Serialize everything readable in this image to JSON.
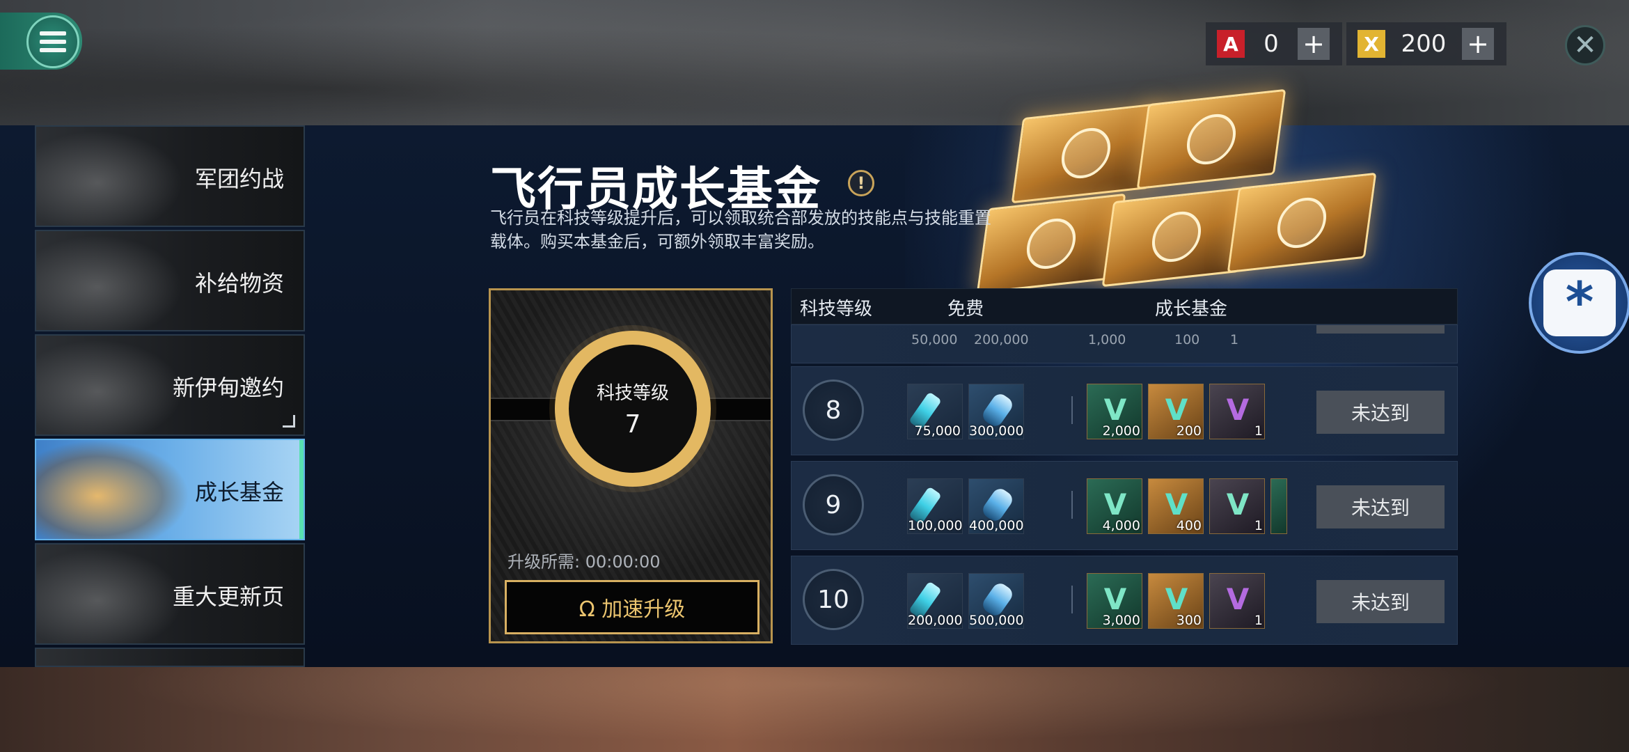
{
  "currency": {
    "item1": {
      "icon": "red-a-currency-icon",
      "value": "0",
      "plus": "+"
    },
    "item2": {
      "icon": "gold-x-currency-icon",
      "value": "200",
      "plus": "+"
    },
    "close": "✕"
  },
  "sidebar": {
    "items": [
      {
        "label": "军团约战"
      },
      {
        "label": "补给物资"
      },
      {
        "label": "新伊甸邀约"
      },
      {
        "label": "成长基金"
      },
      {
        "label": "重大更新页"
      }
    ]
  },
  "fund": {
    "title": "飞行员成长基金",
    "info": "!",
    "description": "飞行员在科技等级提升后，可以领取统合部发放的技能点与技能重置载体。购买本基金后，可额外领取丰富奖励。"
  },
  "level_card": {
    "label": "科技等级",
    "value": "7",
    "upgrade_need": "升级所需: 00:00:00",
    "speed_button": "Ω 加速升级"
  },
  "table": {
    "headers": {
      "level": "科技等级",
      "free": "免费",
      "fund": "成长基金"
    },
    "partial_row": {
      "free": [
        "50,000",
        "200,000"
      ],
      "fund": [
        "1,000",
        "100",
        "1"
      ]
    },
    "rows": [
      {
        "level": "8",
        "free": [
          "75,000",
          "300,000"
        ],
        "fund": [
          "2,000",
          "200",
          "1"
        ],
        "status": "未达到"
      },
      {
        "level": "9",
        "free": [
          "100,000",
          "400,000"
        ],
        "fund": [
          "4,000",
          "400",
          "1"
        ],
        "status": "未达到"
      },
      {
        "level": "10",
        "free": [
          "200,000",
          "500,000"
        ],
        "fund": [
          "3,000",
          "300",
          "1"
        ],
        "status": "未达到"
      }
    ]
  },
  "colors": {
    "accent_gold": "#e3b862",
    "active_tab": "#6aaee8",
    "status_btn": "#4a5059"
  }
}
